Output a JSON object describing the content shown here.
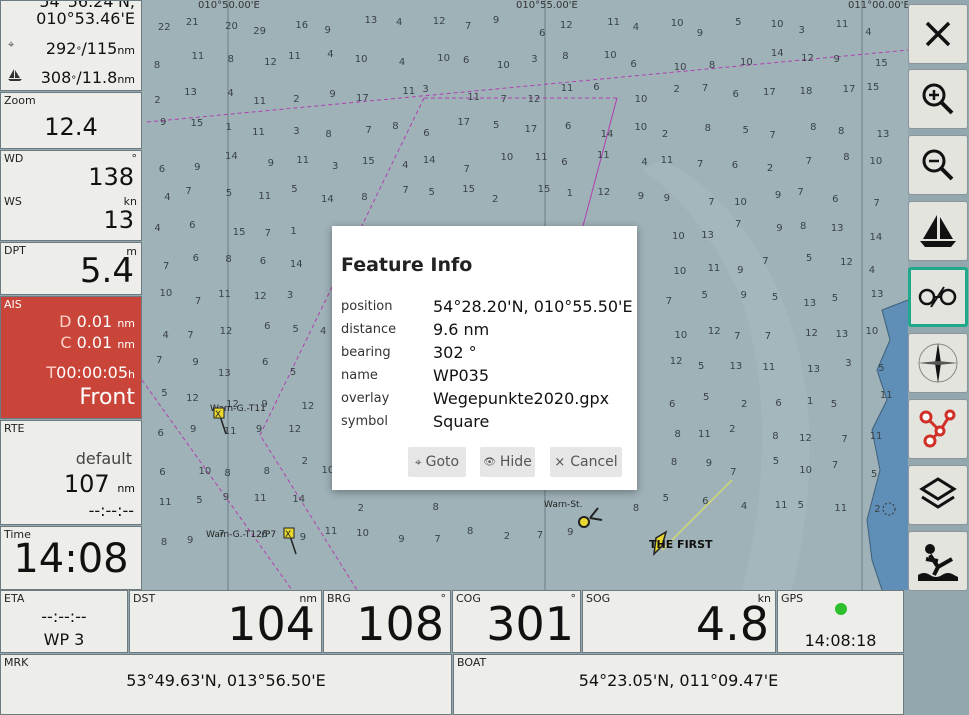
{
  "top_nav": {
    "lat_partial": "54°56.24'N,",
    "lon": "010°53.46'E",
    "course": "292",
    "course_unit": "°",
    "dist": "/115",
    "dist_unit": "nm",
    "boat_course": "308",
    "boat_speed": "/11.8",
    "boat_unit": "nm"
  },
  "zoom": {
    "label": "Zoom",
    "value": "12.4"
  },
  "wind": {
    "wd_label": "WD",
    "wd_unit": "°",
    "wd_value": "138",
    "ws_label": "WS",
    "ws_unit": "kn",
    "ws_value": "13"
  },
  "depth": {
    "label": "DPT",
    "unit": "m",
    "value": "5.4"
  },
  "ais": {
    "label": "AIS",
    "d_label": "D",
    "d_value": "0.01",
    "d_unit": "nm",
    "c_label": "C",
    "c_value": "0.01",
    "c_unit": "nm",
    "t_label": "T",
    "t_value": "00:00:05",
    "t_unit": "h",
    "status": "Front"
  },
  "route": {
    "label": "RTE",
    "name": "default",
    "dist": "107",
    "unit": "nm",
    "eta": "--:--:--"
  },
  "time": {
    "label": "Time",
    "value": "14:08"
  },
  "bottom": {
    "eta_label": "ETA",
    "eta_value": "--:--:--",
    "wp": "WP 3",
    "dst_label": "DST",
    "dst_unit": "nm",
    "dst_value": "104",
    "brg_label": "BRG",
    "brg_unit": "°",
    "brg_value": "108",
    "cog_label": "COG",
    "cog_unit": "°",
    "cog_value": "301",
    "sog_label": "SOG",
    "sog_unit": "kn",
    "sog_value": "4.8",
    "gps_label": "GPS",
    "gps_time": "14:08:18",
    "gps_color": "#2dc02d",
    "mrk_label": "MRK",
    "mrk_value": "53°49.63'N, 013°56.50'E",
    "boat_label": "BOAT",
    "boat_value": "54°23.05'N, 011°09.47'E"
  },
  "dialog": {
    "title": "Feature Info",
    "rows": [
      {
        "key": "position",
        "value": "54°28.20'N, 010°55.50'E"
      },
      {
        "key": "distance",
        "value": "9.6 nm"
      },
      {
        "key": "bearing",
        "value": "302 °"
      },
      {
        "key": "name",
        "value": "WP035"
      },
      {
        "key": "overlay",
        "value": "Wegepunkte2020.gpx"
      },
      {
        "key": "symbol",
        "value": "Square"
      }
    ],
    "goto_label": "Goto",
    "goto_icon": "⌖",
    "hide_label": "Hide",
    "hide_icon": "👁",
    "cancel_label": "Cancel",
    "cancel_icon": "×"
  },
  "map": {
    "lon_labels": [
      "010°50.00'E",
      "010°55.00'E",
      "011°00.00'E"
    ],
    "buoys": [
      "Warn-G.-T11",
      "Warn-G.-T12/P7",
      "Warn-St."
    ],
    "vessel": "THE FIRST",
    "depths": [
      "22",
      "21",
      "20",
      "29",
      "16",
      "9",
      "13",
      "4",
      "12",
      "7",
      "9",
      "6",
      "12",
      "11",
      "4",
      "10",
      "9",
      "5",
      "10",
      "3",
      "11",
      "4",
      "8",
      "11",
      "8",
      "12",
      "11",
      "4",
      "10",
      "4",
      "10",
      "6",
      "10",
      "3",
      "8",
      "10",
      "6",
      "10",
      "8",
      "10",
      "14",
      "12",
      "9",
      "15",
      "2",
      "13",
      "4",
      "11",
      "2",
      "9",
      "17",
      "11",
      "3",
      "11",
      "7",
      "12",
      "11",
      "6",
      "10",
      "2",
      "7",
      "6",
      "17",
      "18",
      "17",
      "15",
      "9",
      "15",
      "1",
      "11",
      "3",
      "8",
      "7",
      "8",
      "6",
      "17",
      "5",
      "17",
      "6",
      "14",
      "10",
      "2",
      "8",
      "5",
      "7",
      "8",
      "8",
      "13",
      "6",
      "9",
      "14",
      "9",
      "11",
      "3",
      "15",
      "4",
      "14",
      "7",
      "10",
      "11",
      "6",
      "11",
      "4",
      "11",
      "7",
      "6",
      "2",
      "7",
      "8",
      "10",
      "4",
      "7",
      "5",
      "11",
      "5",
      "14",
      "8",
      "7",
      "5",
      "15",
      "2",
      "15",
      "1",
      "12",
      "9",
      "9",
      "7",
      "10",
      "9",
      "7",
      "6",
      "7",
      "4",
      "6",
      "15",
      "7",
      "1",
      "13",
      "4",
      "6",
      "8",
      "12",
      "10",
      "6",
      "5",
      "7",
      "6",
      "10",
      "13",
      "7",
      "9",
      "8",
      "13",
      "14",
      "7",
      "6",
      "8",
      "6",
      "14",
      "2",
      "12",
      "8",
      "13",
      "7",
      "9",
      "5",
      "12",
      "11",
      "2",
      "10",
      "11",
      "9",
      "7",
      "5",
      "12",
      "4",
      "10",
      "7",
      "11",
      "12",
      "3",
      "5",
      "9",
      "6",
      "12",
      "5",
      "14",
      "11",
      "4",
      "8",
      "12",
      "7",
      "5",
      "9",
      "5",
      "13",
      "5",
      "13",
      "4",
      "7",
      "12",
      "6",
      "5",
      "4",
      "12",
      "12",
      "7",
      "14",
      "10",
      "13",
      "12",
      "10",
      "4",
      "10",
      "12",
      "7",
      "7",
      "12",
      "13",
      "10",
      "7",
      "9",
      "13",
      "6",
      "5",
      "2",
      "6",
      "5",
      "12",
      "13",
      "8",
      "7",
      "8",
      "14",
      "4",
      "12",
      "5",
      "13",
      "11",
      "13",
      "3",
      "5",
      "5",
      "12",
      "12",
      "9",
      "12",
      "12",
      "1",
      "8",
      "4",
      "7",
      "5",
      "8",
      "9",
      "2",
      "8",
      "6",
      "5",
      "2",
      "6",
      "1",
      "5",
      "11",
      "6",
      "9",
      "11",
      "9",
      "12",
      "14",
      "12",
      "4",
      "10",
      "5",
      "12",
      "14",
      "12",
      "10",
      "13",
      "8",
      "11",
      "2",
      "8",
      "12",
      "7",
      "11",
      "6",
      "10",
      "8",
      "8",
      "2",
      "10",
      "4",
      "8",
      "8",
      "8",
      "7",
      "6",
      "10",
      "8",
      "2",
      "8",
      "9",
      "7",
      "5",
      "10",
      "7",
      "5",
      "11",
      "5",
      "9",
      "11",
      "14",
      "10",
      "2",
      "7",
      "8",
      "3",
      "14",
      "14",
      "10",
      "3",
      "8",
      "5",
      "6",
      "4",
      "11",
      "5",
      "11",
      "2",
      "8",
      "9",
      "7",
      "6",
      "9",
      "11",
      "10",
      "9",
      "7",
      "8",
      "2",
      "7",
      "9"
    ]
  }
}
